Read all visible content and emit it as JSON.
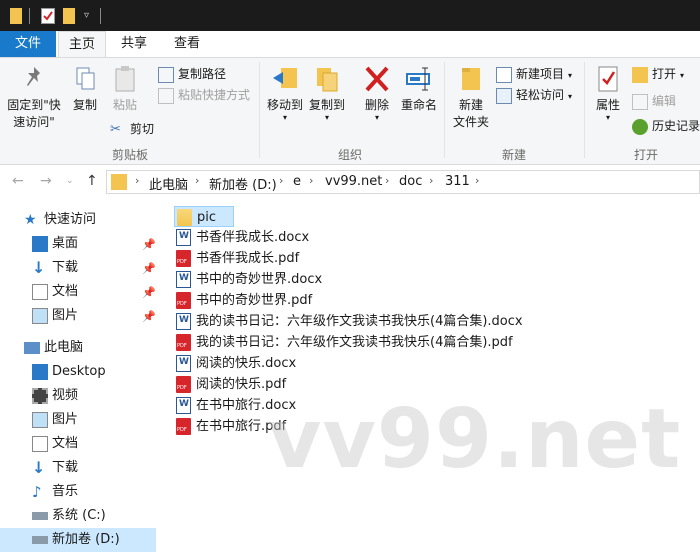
{
  "ribbon": {
    "tabs": [
      "文件",
      "主页",
      "共享",
      "查看"
    ],
    "clipboard": {
      "pin_label_1": "固定到\"快",
      "pin_label_2": "速访问\"",
      "copy": "复制",
      "paste": "粘贴",
      "copy_path": "复制路径",
      "paste_shortcut": "粘贴快捷方式",
      "cut": "剪切",
      "group": "剪贴板"
    },
    "organize": {
      "move_to": "移动到",
      "copy_to": "复制到",
      "delete": "删除",
      "rename": "重命名",
      "group": "组织"
    },
    "new": {
      "new_folder_1": "新建",
      "new_folder_2": "文件夹",
      "new_item": "新建项目",
      "easy_access": "轻松访问",
      "group": "新建"
    },
    "open": {
      "properties": "属性",
      "open": "打开",
      "edit": "编辑",
      "history": "历史记录",
      "group": "打开"
    }
  },
  "address": {
    "crumbs": [
      "此电脑",
      "新加卷 (D:)",
      "e",
      "vv99.net",
      "doc",
      "311"
    ]
  },
  "nav": {
    "quick_access": "快速访问",
    "items": [
      {
        "label": "桌面",
        "icon": "desktop-icon",
        "pinned": true
      },
      {
        "label": "下载",
        "icon": "download-icon",
        "pinned": true
      },
      {
        "label": "文档",
        "icon": "document-icon",
        "pinned": true
      },
      {
        "label": "图片",
        "icon": "picture-icon",
        "pinned": true
      }
    ],
    "this_pc": "此电脑",
    "pc_items": [
      {
        "label": "Desktop",
        "icon": "desktop-icon"
      },
      {
        "label": "视频",
        "icon": "video-icon"
      },
      {
        "label": "图片",
        "icon": "picture-icon"
      },
      {
        "label": "文档",
        "icon": "document-icon"
      },
      {
        "label": "下载",
        "icon": "download-icon"
      },
      {
        "label": "音乐",
        "icon": "music-icon"
      },
      {
        "label": "系统 (C:)",
        "icon": "drive-icon"
      },
      {
        "label": "新加卷 (D:)",
        "icon": "drive-icon"
      }
    ]
  },
  "files": [
    {
      "name": "pic",
      "type": "folder"
    },
    {
      "name": "书香伴我成长.docx",
      "type": "docx"
    },
    {
      "name": "书香伴我成长.pdf",
      "type": "pdf"
    },
    {
      "name": "书中的奇妙世界.docx",
      "type": "docx"
    },
    {
      "name": "书中的奇妙世界.pdf",
      "type": "pdf"
    },
    {
      "name": "我的读书日记：六年级作文我读书我快乐(4篇合集).docx",
      "type": "docx"
    },
    {
      "name": "我的读书日记：六年级作文我读书我快乐(4篇合集).pdf",
      "type": "pdf"
    },
    {
      "name": "阅读的快乐.docx",
      "type": "docx"
    },
    {
      "name": "阅读的快乐.pdf",
      "type": "pdf"
    },
    {
      "name": "在书中旅行.docx",
      "type": "docx"
    },
    {
      "name": "在书中旅行.pdf",
      "type": "pdf"
    }
  ],
  "watermark": "vv99.net",
  "colors": {
    "accent": "#1979ca",
    "selection": "#cce8ff",
    "folder": "#f3c550",
    "pdf": "#d6262c",
    "word": "#2b5797"
  }
}
